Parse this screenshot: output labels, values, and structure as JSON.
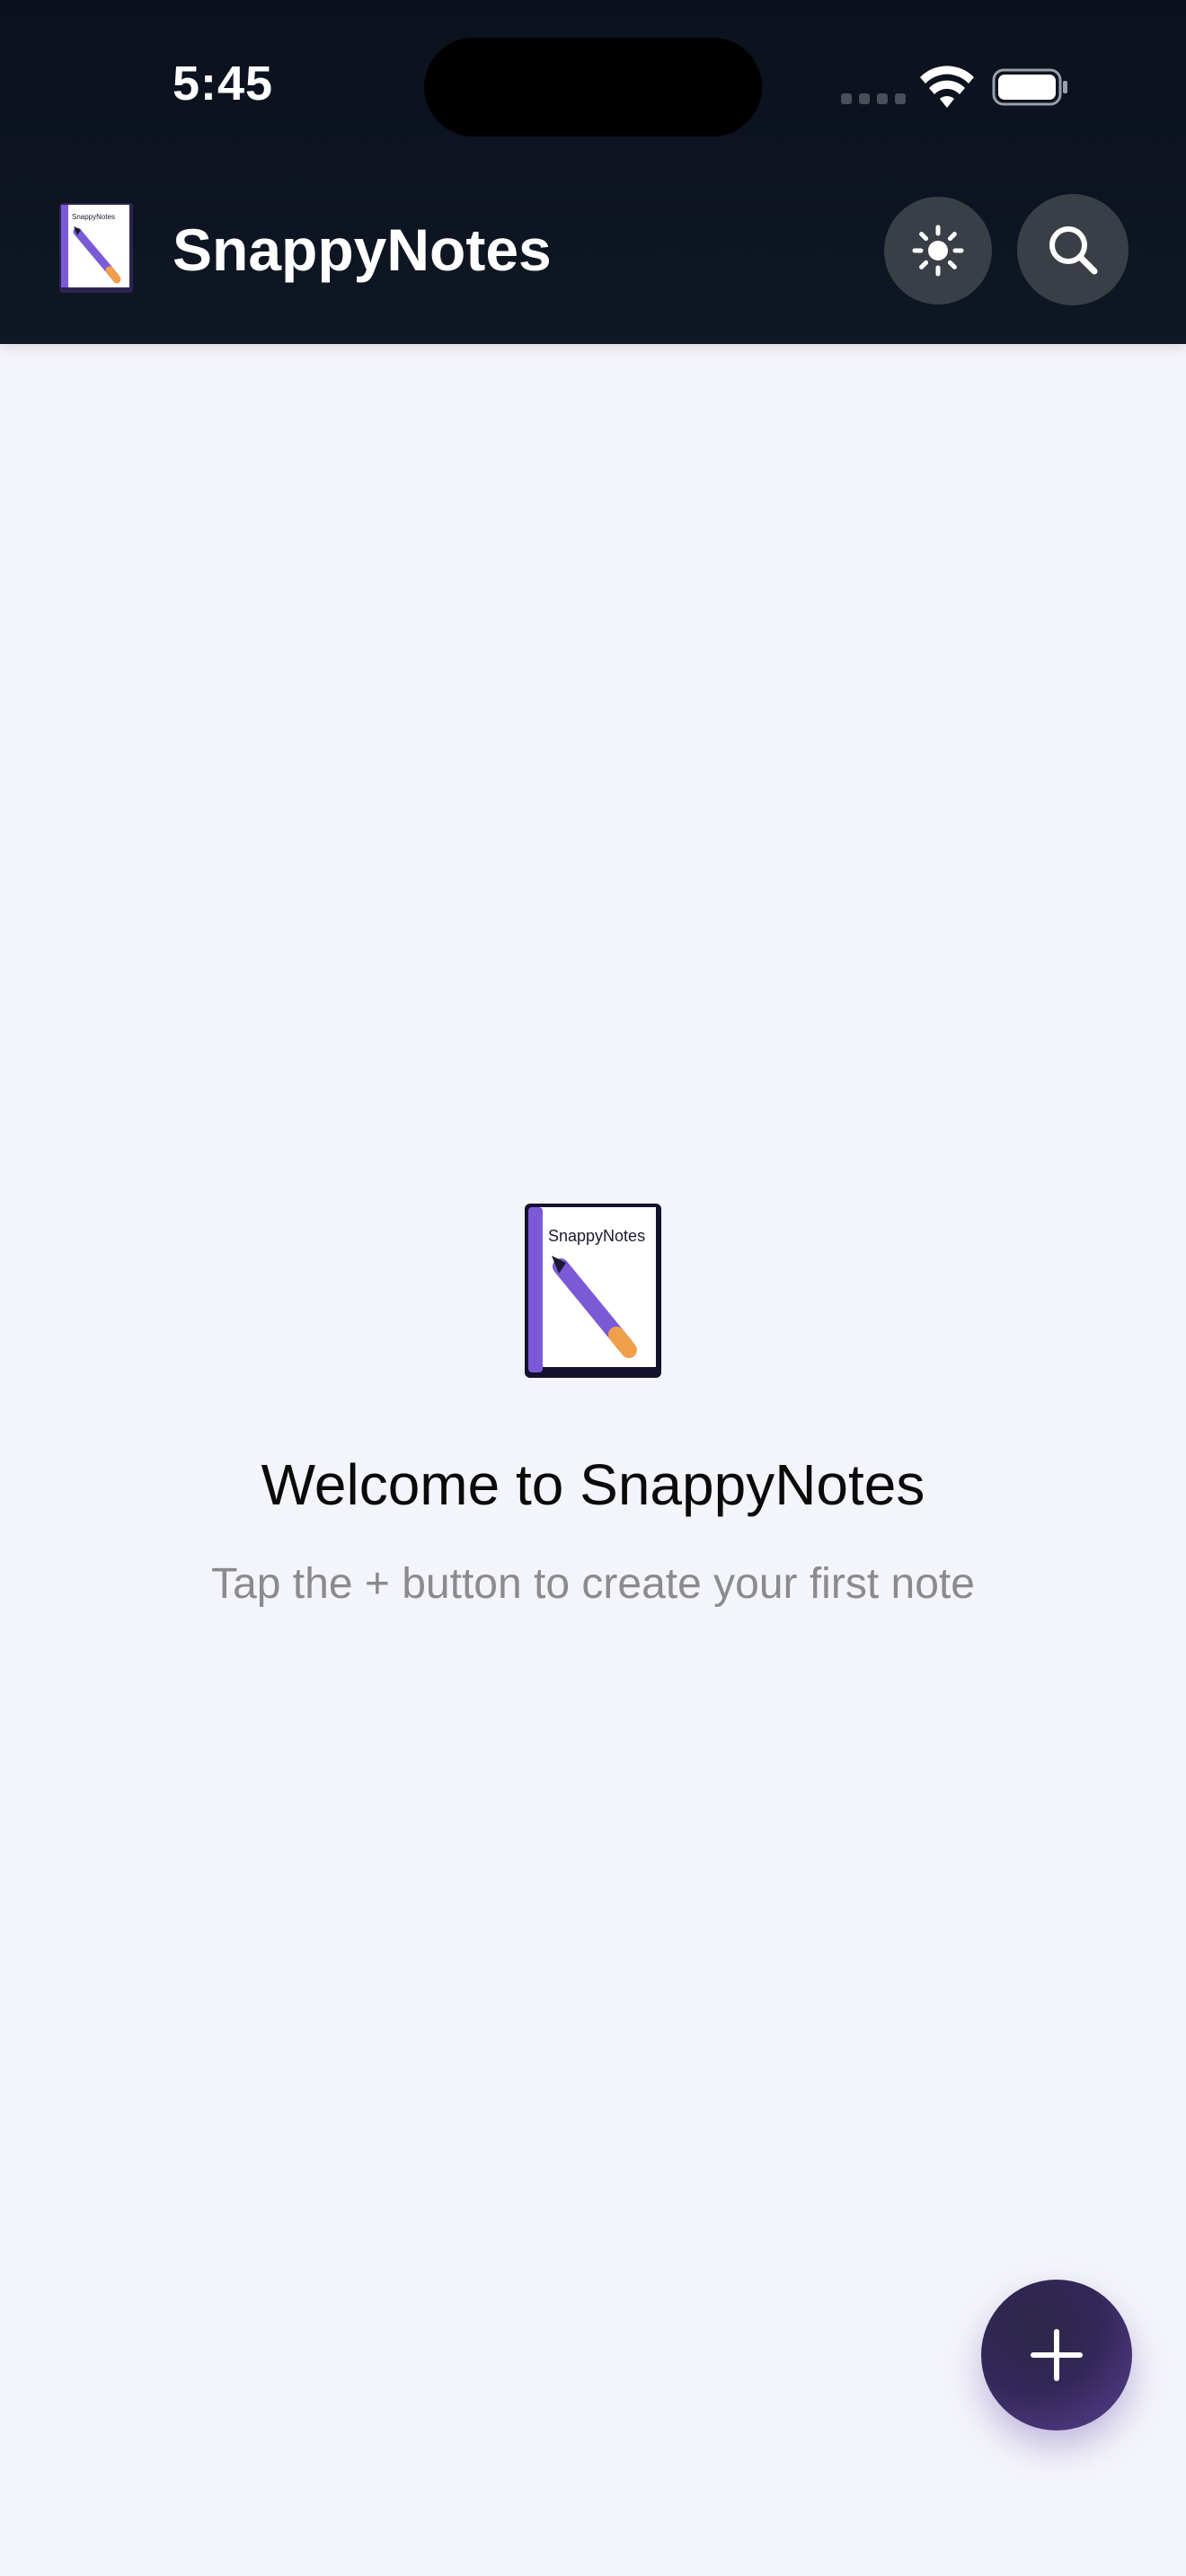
{
  "status_bar": {
    "time": "5:45"
  },
  "header": {
    "app_title": "SnappyNotes",
    "logo_text": "SnappyNotes",
    "theme_icon": "sun-icon",
    "search_icon": "search-icon"
  },
  "empty_state": {
    "logo_text": "SnappyNotes",
    "title": "Welcome to SnappyNotes",
    "subtitle": "Tap the + button to create your first note"
  },
  "fab": {
    "icon": "plus-icon"
  },
  "colors": {
    "header_bg": "#0b111d",
    "page_bg": "#f4f5fa",
    "accent": "#5a3f92",
    "subtitle_text": "#8a8a8f"
  }
}
